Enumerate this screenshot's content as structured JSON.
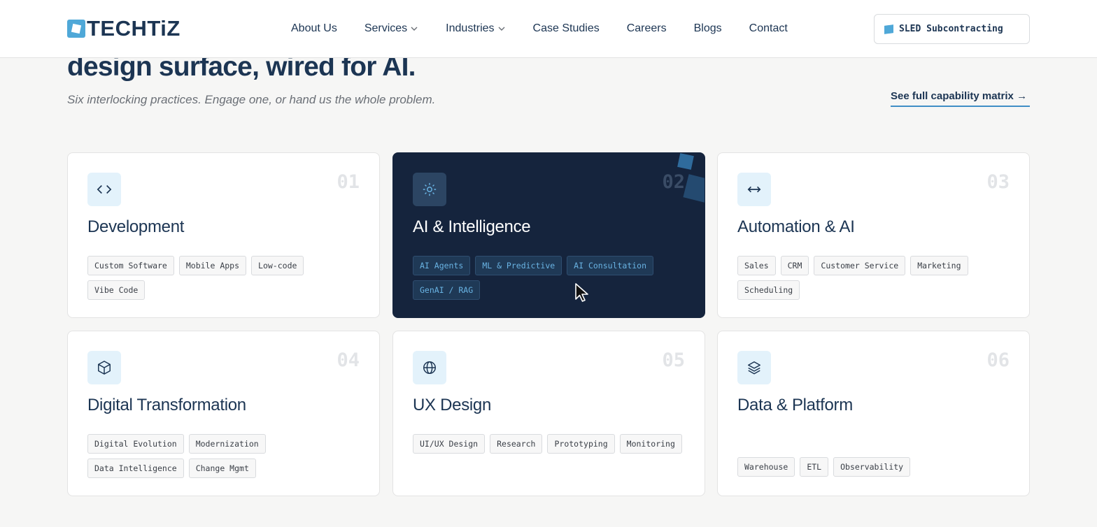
{
  "nav": {
    "logo_text": "TECHTiZ",
    "links": [
      "About Us",
      "Services",
      "Industries",
      "Case Studies",
      "Careers",
      "Blogs",
      "Contact"
    ],
    "cta_label": "SLED Subcontracting"
  },
  "hero": {
    "title_line": "design surface, wired for AI.",
    "subtitle": "Six interlocking practices. Engage one, or hand us the whole problem.",
    "matrix_link": "See full capability matrix →"
  },
  "cards": [
    {
      "num": "01",
      "title": "Development",
      "icon": "code-icon",
      "tags": [
        "Custom Software",
        "Mobile Apps",
        "Low-code",
        "Vibe Code"
      ]
    },
    {
      "num": "02",
      "title": "AI & Intelligence",
      "icon": "sun-icon",
      "tags": [
        "AI Agents",
        "ML & Predictive",
        "AI Consultation",
        "GenAI / RAG"
      ]
    },
    {
      "num": "03",
      "title": "Automation & AI",
      "icon": "arrows-icon",
      "tags": [
        "Sales",
        "CRM",
        "Customer Service",
        "Marketing",
        "Scheduling"
      ]
    },
    {
      "num": "04",
      "title": "Digital Transformation",
      "icon": "cube-icon",
      "tags": [
        "Digital Evolution",
        "Modernization",
        "Data Intelligence",
        "Change Mgmt"
      ]
    },
    {
      "num": "05",
      "title": "UX Design",
      "icon": "globe-icon",
      "tags": [
        "UI/UX Design",
        "Research",
        "Prototyping",
        "Monitoring"
      ]
    },
    {
      "num": "06",
      "title": "Data & Platform",
      "icon": "layers-icon",
      "tags": [
        "Warehouse",
        "ETL",
        "Observability"
      ]
    }
  ],
  "colors": {
    "navy": "#1c3553",
    "accent": "#4fa8d8",
    "dark_card": "#15243d",
    "tag_dark_text": "#69b3e3"
  }
}
